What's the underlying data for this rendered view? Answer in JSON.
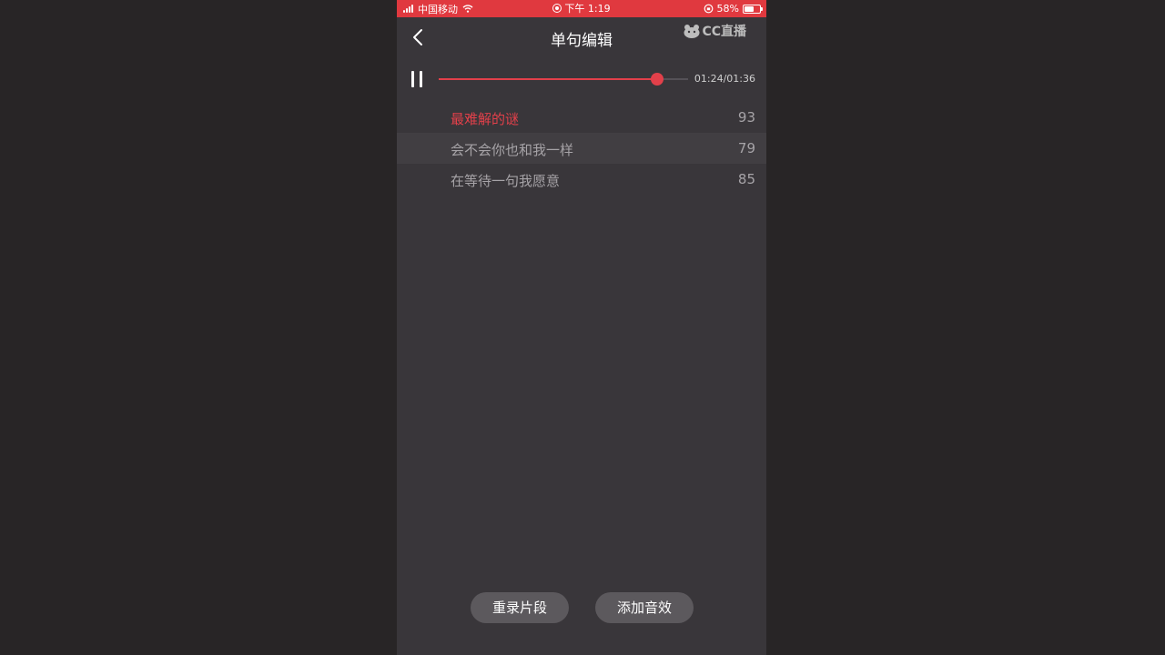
{
  "status_bar": {
    "carrier": "中国移动",
    "time": "下午 1:19",
    "battery_percent": "58%",
    "battery_level": 0.58,
    "bg_color": "#e0393f"
  },
  "header": {
    "title": "单句编辑",
    "back_icon": "chevron-left-icon",
    "logo_text": "CC直播"
  },
  "player": {
    "state": "playing",
    "control_icon": "pause-icon",
    "progress_fraction": 0.875,
    "time_display": "01:24/01:36",
    "accent_color": "#e2404a"
  },
  "lyrics": [
    {
      "text": "最难解的谜",
      "score": "93",
      "active": true
    },
    {
      "text": "会不会你也和我一样",
      "score": "79",
      "active": false
    },
    {
      "text": "在等待一句我愿意",
      "score": "85",
      "active": false
    }
  ],
  "actions": {
    "rerecord_label": "重录片段",
    "add_effect_label": "添加音效"
  }
}
